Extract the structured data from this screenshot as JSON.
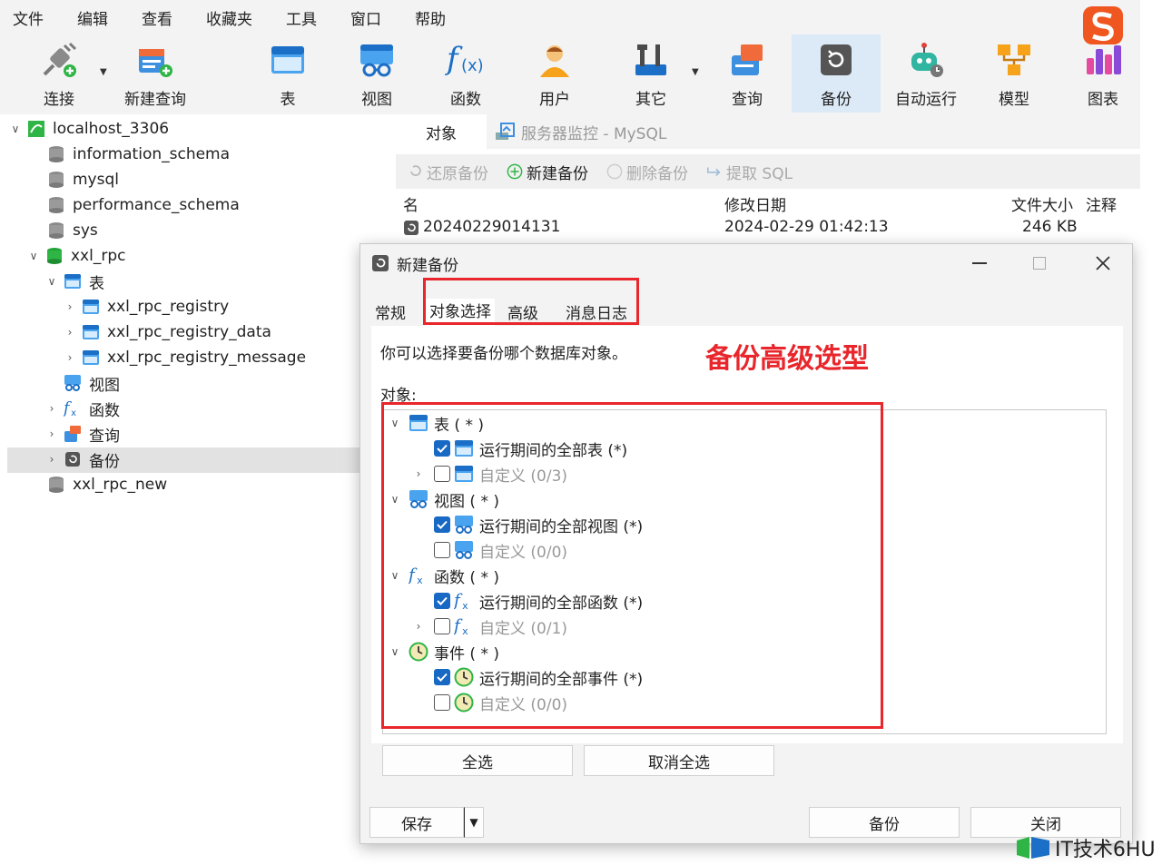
{
  "menu": [
    "文件",
    "编辑",
    "查看",
    "收藏夹",
    "工具",
    "窗口",
    "帮助"
  ],
  "toolbar": {
    "connect": "连接",
    "new_query": "新建查询",
    "table": "表",
    "view": "视图",
    "function": "函数",
    "user": "用户",
    "other": "其它",
    "query": "查询",
    "backup": "备份",
    "automation": "自动运行",
    "model": "模型",
    "chart": "图表"
  },
  "tree": {
    "connection": "localhost_3306",
    "dbs": [
      "information_schema",
      "mysql",
      "performance_schema",
      "sys"
    ],
    "xxl_rpc": "xxl_rpc",
    "tables_group": "表",
    "tables": [
      "xxl_rpc_registry",
      "xxl_rpc_registry_data",
      "xxl_rpc_registry_message"
    ],
    "views": "视图",
    "functions": "函数",
    "queries": "查询",
    "backups": "备份",
    "xxl_rpc_new": "xxl_rpc_new"
  },
  "right_panel": {
    "tab_objects": "对象",
    "tab_monitor": "服务器监控 - MySQL",
    "actions": {
      "restore": "还原备份",
      "new": "新建备份",
      "delete": "删除备份",
      "extract": "提取 SQL"
    },
    "columns": {
      "name": "名",
      "modified": "修改日期",
      "size": "文件大小",
      "comment": "注释"
    },
    "row": {
      "name": "20240229014131",
      "modified": "2024-02-29 01:42:13",
      "size": "246 KB"
    }
  },
  "dialog": {
    "title": "新建备份",
    "tabs": {
      "general": "常规",
      "object_selection": "对象选择",
      "advanced": "高级",
      "message_log": "消息日志"
    },
    "description": "你可以选择要备份哪个数据库对象。",
    "objects_label": "对象:",
    "groups": {
      "tables": "表 ( * )",
      "tables_all": "运行期间的全部表 (*)",
      "tables_custom": "自定义 (0/3)",
      "views": "视图 ( * )",
      "views_all": "运行期间的全部视图 (*)",
      "views_custom": "自定义 (0/0)",
      "functions": "函数 ( * )",
      "functions_all": "运行期间的全部函数 (*)",
      "functions_custom": "自定义 (0/1)",
      "events": "事件 ( * )",
      "events_all": "运行期间的全部事件 (*)",
      "events_custom": "自定义 (0/0)"
    },
    "select_all": "全选",
    "deselect_all": "取消全选",
    "save": "保存",
    "backup": "备份",
    "close": "关闭"
  },
  "annotation": "备份高级选型",
  "watermark": "IT技术6HU",
  "colors": {
    "accent": "#1769c4",
    "annotation": "#e8262b",
    "selected_row": "#e2e2e2",
    "active_tool": "#dce9f7"
  }
}
